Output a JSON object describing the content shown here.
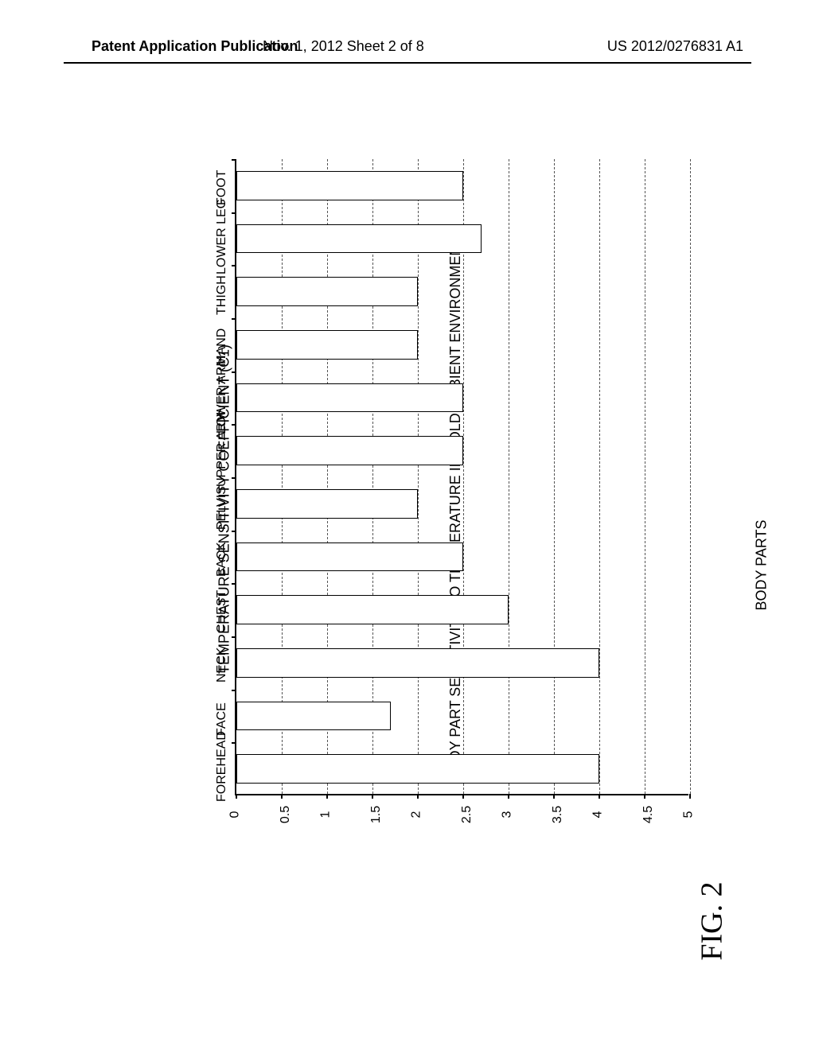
{
  "header": {
    "left": "Patent Application Publication",
    "center": "Nov. 1, 2012   Sheet 2 of 8",
    "right": "US 2012/0276831 A1"
  },
  "figure_label": "FIG.  2",
  "chart_data": {
    "type": "bar",
    "title": "BODY PART SENSITIVITY TO TEMPERATURE IN COLD AMBIENT ENVIRONMENT",
    "ylabel": "TEMPERATURE SENSITIVITY COEFFICIENT (C1)",
    "xlabel": "BODY PARTS",
    "ylim": [
      0,
      5
    ],
    "yticks": [
      0,
      0.5,
      1,
      1.5,
      2,
      2.5,
      3,
      3.5,
      4,
      4.5,
      5
    ],
    "categories": [
      "FOREHEAD",
      "FACE",
      "NECK",
      "CHEST",
      "BACK",
      "PELVIS",
      "UPPER ARM",
      "LOWER ARM",
      "HAND",
      "THIGH",
      "LOWER LEG",
      "FOOT"
    ],
    "values": [
      4.0,
      1.7,
      4.0,
      3.0,
      2.5,
      2.0,
      2.5,
      2.5,
      2.0,
      2.0,
      2.7,
      2.5
    ]
  }
}
